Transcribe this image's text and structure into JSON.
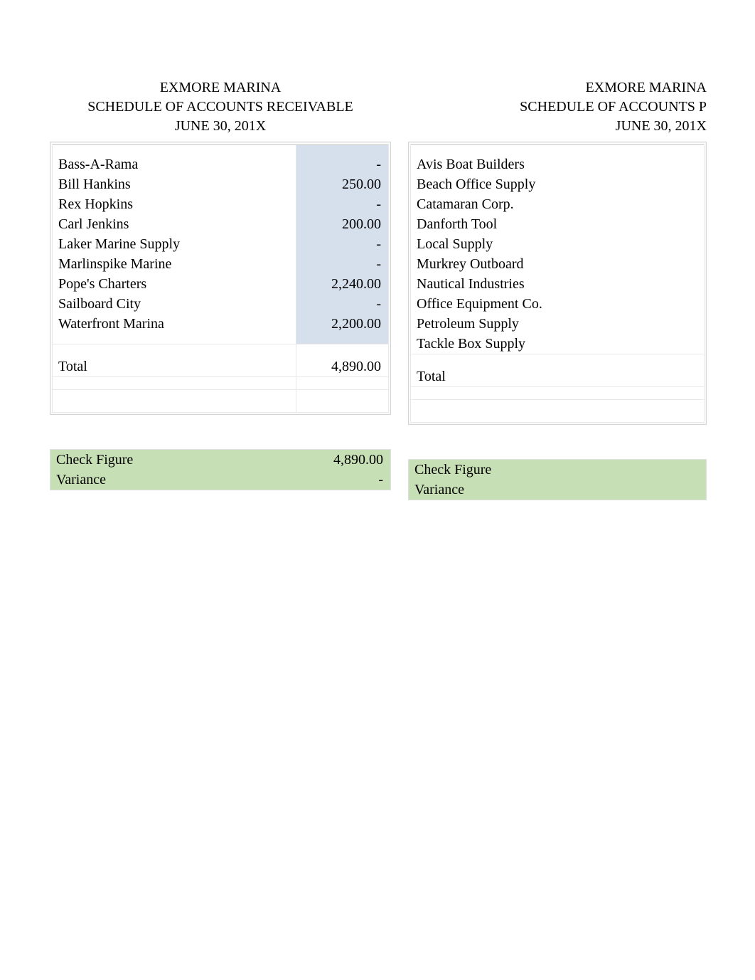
{
  "receivable": {
    "company": "EXMORE MARINA",
    "title": "SCHEDULE OF ACCOUNTS RECEIVABLE",
    "date": "JUNE 30, 201X",
    "rows": [
      {
        "name": "Bass-A-Rama",
        "value": "-"
      },
      {
        "name": "Bill Hankins",
        "value": "250.00"
      },
      {
        "name": "Rex Hopkins",
        "value": "-"
      },
      {
        "name": "Carl Jenkins",
        "value": "200.00"
      },
      {
        "name": "Laker Marine Supply",
        "value": "-"
      },
      {
        "name": "Marlinspike Marine",
        "value": "-"
      },
      {
        "name": "Pope's Charters",
        "value": "2,240.00"
      },
      {
        "name": "Sailboard City",
        "value": "-"
      },
      {
        "name": "Waterfront Marina",
        "value": "2,200.00"
      }
    ],
    "total_label": "Total",
    "total_value": "4,890.00",
    "check_label": "Check Figure",
    "check_value": "4,890.00",
    "variance_label": "Variance",
    "variance_value": "-"
  },
  "payable": {
    "company": "EXMORE MARINA",
    "title": "SCHEDULE OF ACCOUNTS P",
    "date": "JUNE 30, 201X",
    "rows": [
      {
        "name": "Avis Boat Builders",
        "value": ""
      },
      {
        "name": "Beach Office Supply",
        "value": ""
      },
      {
        "name": "Catamaran Corp.",
        "value": ""
      },
      {
        "name": "Danforth Tool",
        "value": ""
      },
      {
        "name": "Local Supply",
        "value": ""
      },
      {
        "name": "Murkrey Outboard",
        "value": ""
      },
      {
        "name": "Nautical Industries",
        "value": ""
      },
      {
        "name": "Office Equipment Co.",
        "value": ""
      },
      {
        "name": "Petroleum Supply",
        "value": ""
      },
      {
        "name": "Tackle Box Supply",
        "value": ""
      }
    ],
    "total_label": "Total",
    "total_value": "",
    "check_label": "Check Figure",
    "check_value": "",
    "variance_label": "Variance",
    "variance_value": ""
  }
}
